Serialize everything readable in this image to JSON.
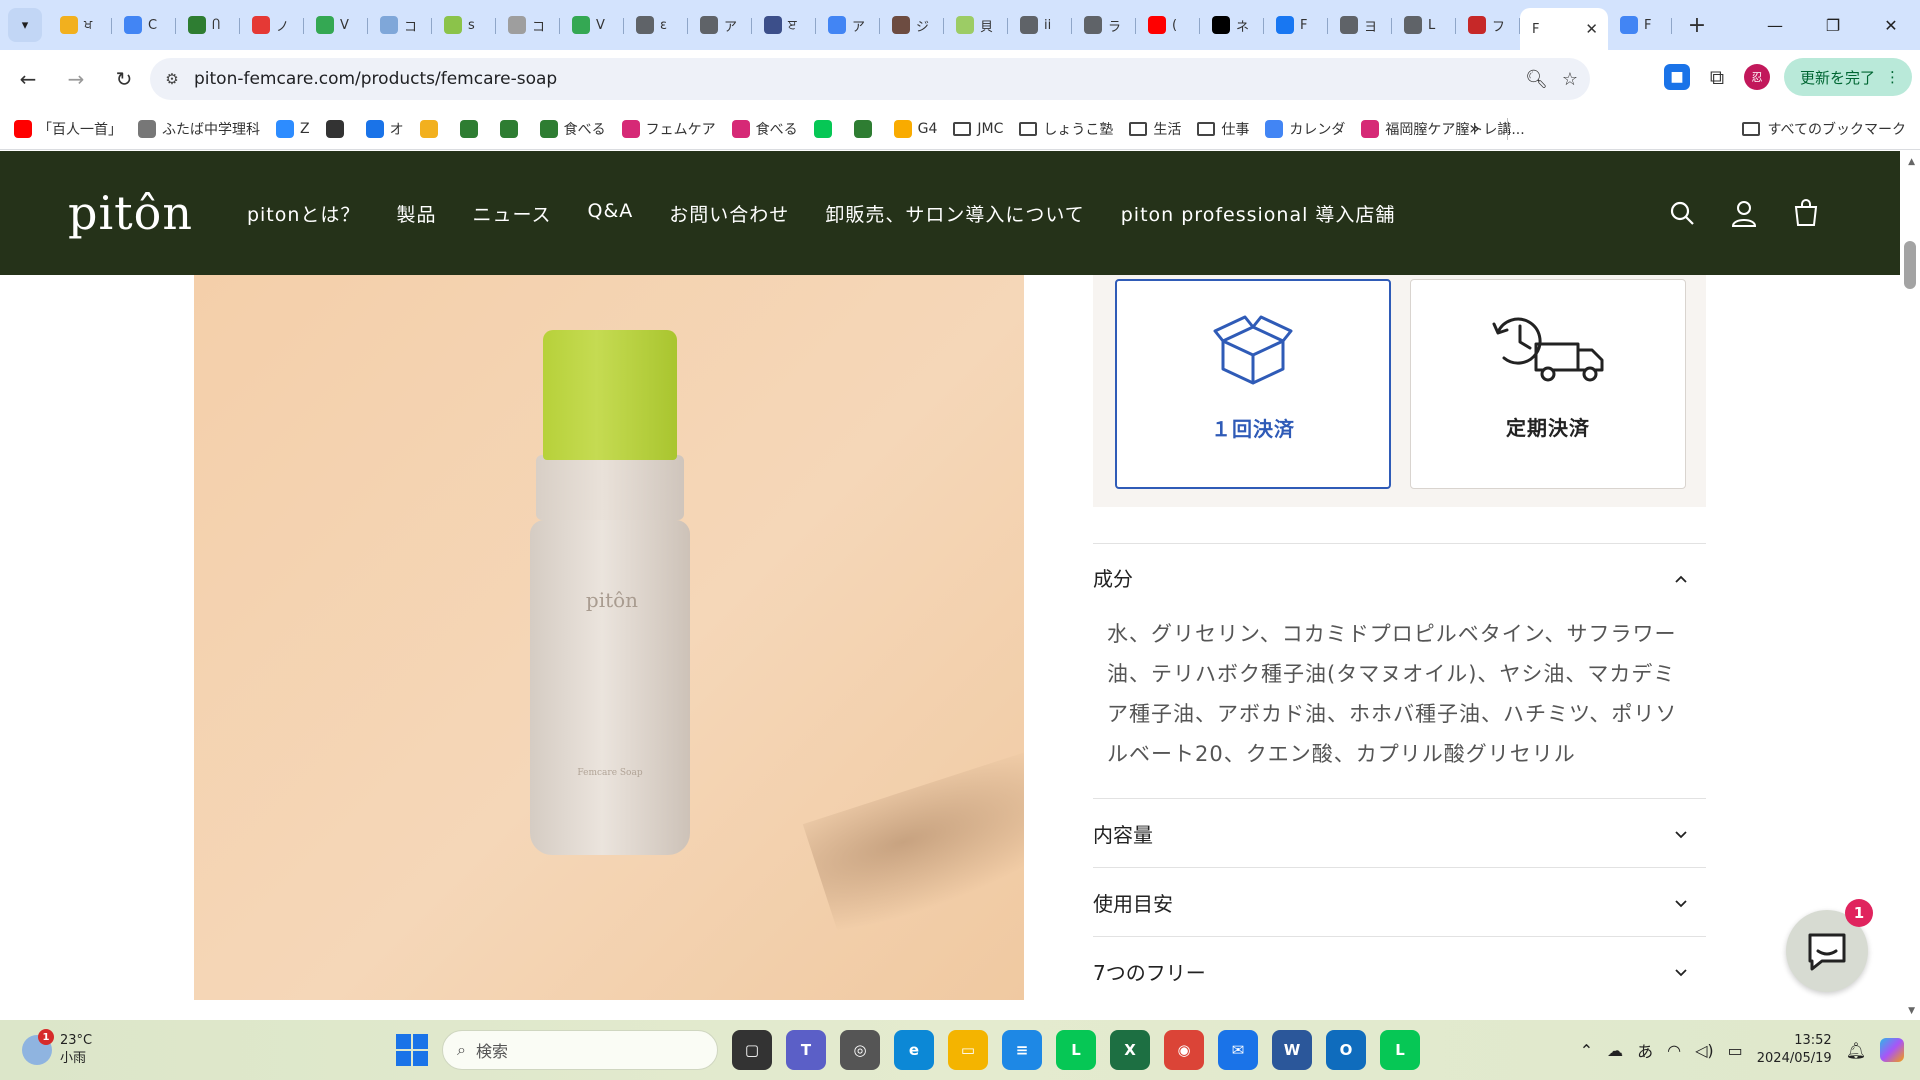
{
  "browser": {
    "tabs": [
      {
        "label": "ਖ",
        "color": "#f2b01e"
      },
      {
        "label": "C",
        "color": "#4285f4"
      },
      {
        "label": "Ⴖ",
        "color": "#2e7d32"
      },
      {
        "label": "ノ",
        "color": "#e53935"
      },
      {
        "label": "V",
        "color": "#34a853"
      },
      {
        "label": "コ",
        "color": "#7fa7d9"
      },
      {
        "label": "s",
        "color": "#8bc34a"
      },
      {
        "label": "コ",
        "color": "#9e9e9e"
      },
      {
        "label": "V",
        "color": "#34a853"
      },
      {
        "label": "ε",
        "color": "#5f6368"
      },
      {
        "label": "ア",
        "color": "#5f6368"
      },
      {
        "label": "ੲ",
        "color": "#3c4f8a"
      },
      {
        "label": "ア",
        "color": "#4285f4"
      },
      {
        "label": "ジ",
        "color": "#6d4c41"
      },
      {
        "label": "貝",
        "color": "#9ccc65"
      },
      {
        "label": "ii",
        "color": "#5f6368"
      },
      {
        "label": "ラ",
        "color": "#5f6368"
      },
      {
        "label": "(",
        "color": "#ff0000"
      },
      {
        "label": "ネ",
        "color": "#000000"
      },
      {
        "label": "F",
        "color": "#1877f2"
      },
      {
        "label": "ヨ",
        "color": "#5f6368"
      },
      {
        "label": "L",
        "color": "#5f6368"
      },
      {
        "label": "フ",
        "color": "#c62828"
      }
    ],
    "active_tab": {
      "label": "F"
    },
    "last_tab": {
      "label": "F",
      "color": "#4285f4"
    },
    "url": "piton-femcare.com/products/femcare-soap",
    "update_label": "更新を完了",
    "profile_initial": "忍"
  },
  "bookmarks": [
    {
      "label": "「百人一首」",
      "color": "#ff0000",
      "type": "site"
    },
    {
      "label": "ふたば中学理科",
      "color": "#777777",
      "type": "site"
    },
    {
      "label": "Z",
      "color": "#2d8cff",
      "type": "site"
    },
    {
      "label": "",
      "color": "#333333",
      "type": "site"
    },
    {
      "label": "オ",
      "color": "#1a73e8",
      "type": "site"
    },
    {
      "label": "",
      "color": "#f2b01e",
      "type": "site"
    },
    {
      "label": "",
      "color": "#2e7d32",
      "type": "site"
    },
    {
      "label": "",
      "color": "#2e7d32",
      "type": "site"
    },
    {
      "label": "食べる",
      "color": "#2e7d32",
      "type": "site"
    },
    {
      "label": "フェムケア",
      "color": "#d62976",
      "type": "site"
    },
    {
      "label": "食べる",
      "color": "#d62976",
      "type": "site"
    },
    {
      "label": "",
      "color": "#06c755",
      "type": "site"
    },
    {
      "label": "",
      "color": "#2e7d32",
      "type": "site"
    },
    {
      "label": "G4",
      "color": "#f9ab00",
      "type": "site"
    },
    {
      "label": "JMC",
      "color": "#444444",
      "type": "folder"
    },
    {
      "label": "しょうこ塾",
      "color": "#444444",
      "type": "folder"
    },
    {
      "label": "生活",
      "color": "#444444",
      "type": "folder"
    },
    {
      "label": "仕事",
      "color": "#444444",
      "type": "folder"
    },
    {
      "label": "カレンダ",
      "color": "#4285f4",
      "type": "site"
    },
    {
      "label": "福岡膣ケア膣トレ講...",
      "color": "#d62976",
      "type": "site"
    }
  ],
  "bookmarks_all": "すべてのブックマーク",
  "site": {
    "logo": "pitôn",
    "nav": [
      "pitonとは？",
      "製品",
      "ニュース",
      "Q&A",
      "お問い合わせ",
      "卸販売、サロン導入について",
      "piton professional 導入店舗"
    ],
    "header_bg": "#253219"
  },
  "product": {
    "bottle_brand": "pitôn",
    "bottle_sub": "Femcare Soap"
  },
  "payment": {
    "one_time": "１回決済",
    "subscription": "定期決済",
    "selected": "one_time",
    "accent": "#2f5bb7"
  },
  "accordion": [
    {
      "title": "成分",
      "open": true,
      "body": "水、グリセリン、コカミドプロピルベタイン、サフラワー油、テリハボク種子油(タマヌオイル)、ヤシ油、マカデミア種子油、アボカド油、ホホバ種子油、ハチミツ、ポリソルベート20、クエン酸、カプリル酸グリセリル"
    },
    {
      "title": "内容量",
      "open": false
    },
    {
      "title": "使用目安",
      "open": false
    },
    {
      "title": "7つのフリー",
      "open": false
    }
  ],
  "chat": {
    "badge": "1"
  },
  "taskbar": {
    "weather_temp": "23°C",
    "weather_desc": "小雨",
    "weather_badge": "1",
    "search_placeholder": "検索",
    "ime": "あ",
    "time": "13:52",
    "date": "2024/05/19",
    "apps": [
      {
        "name": "task-view",
        "color": "#333333",
        "glyph": "▢"
      },
      {
        "name": "teams",
        "color": "#5b5fc7",
        "glyph": "T"
      },
      {
        "name": "app",
        "color": "#555555",
        "glyph": "◎"
      },
      {
        "name": "edge",
        "color": "#0c88d6",
        "glyph": "e"
      },
      {
        "name": "explorer",
        "color": "#f4b400",
        "glyph": "▭"
      },
      {
        "name": "notepad",
        "color": "#1e88e5",
        "glyph": "≡"
      },
      {
        "name": "line",
        "color": "#06c755",
        "glyph": "L"
      },
      {
        "name": "excel",
        "color": "#1d6f42",
        "glyph": "X"
      },
      {
        "name": "chrome",
        "color": "#db4437",
        "glyph": "◉"
      },
      {
        "name": "mail",
        "color": "#1a73e8",
        "glyph": "✉"
      },
      {
        "name": "word",
        "color": "#2b579a",
        "glyph": "W"
      },
      {
        "name": "outlook",
        "color": "#0f6cbd",
        "glyph": "O"
      },
      {
        "name": "line",
        "color": "#06c755",
        "glyph": "L"
      }
    ]
  }
}
